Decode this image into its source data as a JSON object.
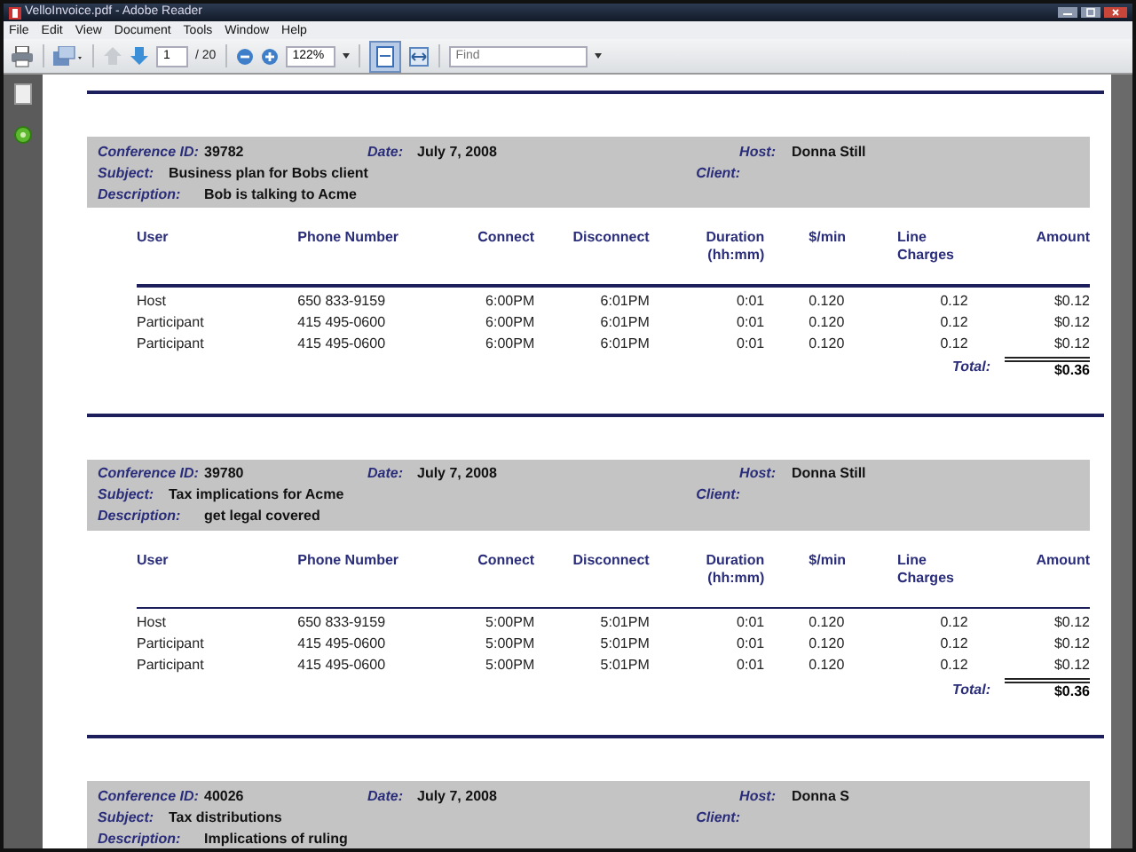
{
  "window": {
    "title": "VelloInvoice.pdf - Adobe Reader"
  },
  "menu": [
    "File",
    "Edit",
    "View",
    "Document",
    "Tools",
    "Window",
    "Help"
  ],
  "toolbar": {
    "page": "1",
    "page_count": "/ 20",
    "zoom": "122%",
    "find_placeholder": "Find",
    "fit_page_selected": true
  },
  "conferences": [
    {
      "id": {
        "label": "Conference ID:",
        "value": "39782"
      },
      "date": {
        "label": "Date:",
        "value": "July 7, 2008"
      },
      "host": {
        "label": "Host:",
        "value": "Donna Still"
      },
      "subject": {
        "label": "Subject:",
        "value": "Business plan for Bobs client"
      },
      "client": {
        "label": "Client:"
      },
      "description": {
        "label": "Description:",
        "value": "Bob is talking to Acme"
      },
      "table": {
        "columns": [
          "User",
          "Phone Number",
          "Connect",
          "Disconnect",
          "Duration (hh:mm)",
          "$/min",
          "Line Charges",
          "Amount"
        ],
        "rows": [
          [
            "Host",
            "650 833-9159",
            "6:00PM",
            "6:01PM",
            "0:01",
            "0.120",
            "0.12",
            "$0.12"
          ],
          [
            "Participant",
            "415 495-0600",
            "6:00PM",
            "6:01PM",
            "0:01",
            "0.120",
            "0.12",
            "$0.12"
          ],
          [
            "Participant",
            "415 495-0600",
            "6:00PM",
            "6:01PM",
            "0:01",
            "0.120",
            "0.12",
            "$0.12"
          ]
        ],
        "total": {
          "label": "Total:",
          "value": "$0.36"
        }
      }
    },
    {
      "id": {
        "label": "Conference ID:",
        "value": "39780"
      },
      "date": {
        "label": "Date:",
        "value": "July 7, 2008"
      },
      "host": {
        "label": "Host:",
        "value": "Donna Still"
      },
      "subject": {
        "label": "Subject:",
        "value": "Tax implications for Acme"
      },
      "client": {
        "label": "Client:"
      },
      "description": {
        "label": "Description:",
        "value": "get legal covered"
      },
      "table": {
        "columns": [
          "User",
          "Phone Number",
          "Connect",
          "Disconnect",
          "Duration (hh:mm)",
          "$/min",
          "Line Charges",
          "Amount"
        ],
        "rows": [
          [
            "Host",
            "650 833-9159",
            "5:00PM",
            "5:01PM",
            "0:01",
            "0.120",
            "0.12",
            "$0.12"
          ],
          [
            "Participant",
            "415 495-0600",
            "5:00PM",
            "5:01PM",
            "0:01",
            "0.120",
            "0.12",
            "$0.12"
          ],
          [
            "Participant",
            "415 495-0600",
            "5:00PM",
            "5:01PM",
            "0:01",
            "0.120",
            "0.12",
            "$0.12"
          ]
        ],
        "total": {
          "label": "Total:",
          "value": "$0.36"
        }
      }
    },
    {
      "id": {
        "label": "Conference ID:",
        "value": "40026"
      },
      "date": {
        "label": "Date:",
        "value": "July 7, 2008"
      },
      "host": {
        "label": "Host:",
        "value": "Donna S"
      },
      "subject": {
        "label": "Subject:",
        "value": "Tax distributions"
      },
      "client": {
        "label": "Client:"
      },
      "description": {
        "label": "Description:",
        "value": "Implications of ruling"
      }
    }
  ]
}
